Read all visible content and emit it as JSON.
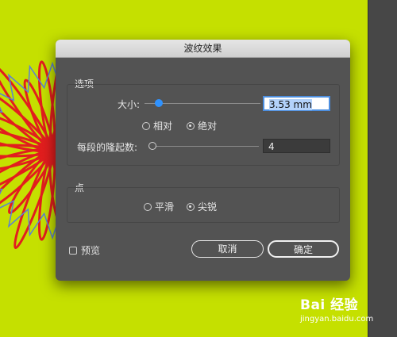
{
  "dialog": {
    "title": "波纹效果"
  },
  "options": {
    "title": "选项",
    "size": {
      "label": "大小:",
      "value": "3.53 mm",
      "slider_level": 0.05
    },
    "size_mode": {
      "relative": "相对",
      "absolute": "绝对",
      "selected": "absolute"
    },
    "ridges": {
      "label": "每段的隆起数:",
      "value": "4",
      "slider_level": 0.0
    }
  },
  "points": {
    "title": "点",
    "smooth": "平滑",
    "corner": "尖锐",
    "selected": "corner"
  },
  "preview": {
    "label": "预览",
    "checked": false
  },
  "buttons": {
    "cancel": "取消",
    "ok": "确定"
  },
  "watermark": {
    "logo": "Bai 经验",
    "url": "jingyan.baidu.com"
  },
  "colors": {
    "canvas": "#c5e000",
    "stroke_red": "#e21e1e",
    "stroke_blue": "#5b7fd6",
    "dialog": "#535353",
    "accent": "#2f92ff"
  }
}
